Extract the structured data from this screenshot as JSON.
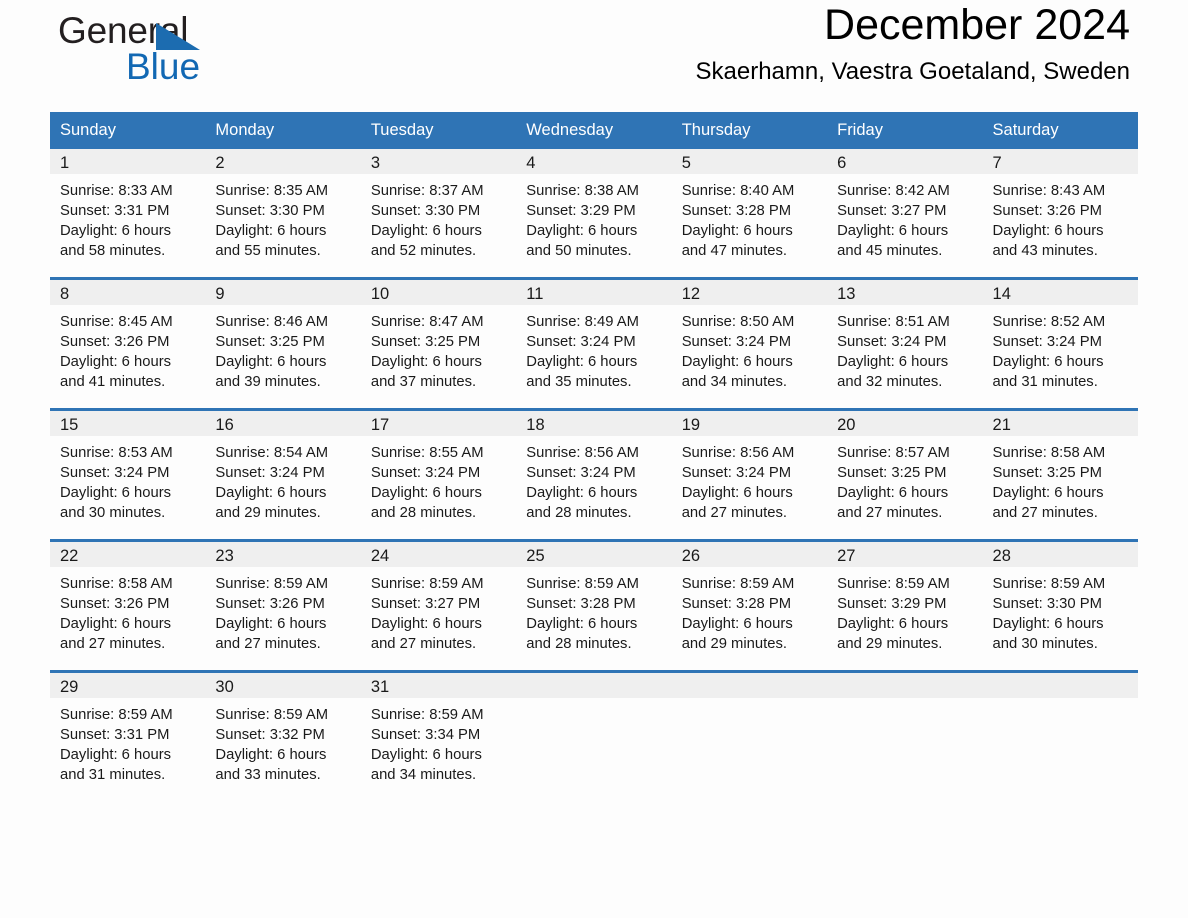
{
  "brand": {
    "name_part1": "General",
    "name_part2": "Blue",
    "triangle_color": "#1c6cb0",
    "blue_color": "#1268b3"
  },
  "header": {
    "title": "December 2024",
    "location": "Skaerhamn, Vaestra Goetaland, Sweden"
  },
  "theme": {
    "header_blue": "#2f74b5",
    "daynum_band": "#efefef",
    "page_background": "#fdfdfd"
  },
  "weekdays": [
    "Sunday",
    "Monday",
    "Tuesday",
    "Wednesday",
    "Thursday",
    "Friday",
    "Saturday"
  ],
  "weeks": [
    [
      {
        "day": "1",
        "sunrise": "Sunrise: 8:33 AM",
        "sunset": "Sunset: 3:31 PM",
        "daylight1": "Daylight: 6 hours",
        "daylight2": "and 58 minutes."
      },
      {
        "day": "2",
        "sunrise": "Sunrise: 8:35 AM",
        "sunset": "Sunset: 3:30 PM",
        "daylight1": "Daylight: 6 hours",
        "daylight2": "and 55 minutes."
      },
      {
        "day": "3",
        "sunrise": "Sunrise: 8:37 AM",
        "sunset": "Sunset: 3:30 PM",
        "daylight1": "Daylight: 6 hours",
        "daylight2": "and 52 minutes."
      },
      {
        "day": "4",
        "sunrise": "Sunrise: 8:38 AM",
        "sunset": "Sunset: 3:29 PM",
        "daylight1": "Daylight: 6 hours",
        "daylight2": "and 50 minutes."
      },
      {
        "day": "5",
        "sunrise": "Sunrise: 8:40 AM",
        "sunset": "Sunset: 3:28 PM",
        "daylight1": "Daylight: 6 hours",
        "daylight2": "and 47 minutes."
      },
      {
        "day": "6",
        "sunrise": "Sunrise: 8:42 AM",
        "sunset": "Sunset: 3:27 PM",
        "daylight1": "Daylight: 6 hours",
        "daylight2": "and 45 minutes."
      },
      {
        "day": "7",
        "sunrise": "Sunrise: 8:43 AM",
        "sunset": "Sunset: 3:26 PM",
        "daylight1": "Daylight: 6 hours",
        "daylight2": "and 43 minutes."
      }
    ],
    [
      {
        "day": "8",
        "sunrise": "Sunrise: 8:45 AM",
        "sunset": "Sunset: 3:26 PM",
        "daylight1": "Daylight: 6 hours",
        "daylight2": "and 41 minutes."
      },
      {
        "day": "9",
        "sunrise": "Sunrise: 8:46 AM",
        "sunset": "Sunset: 3:25 PM",
        "daylight1": "Daylight: 6 hours",
        "daylight2": "and 39 minutes."
      },
      {
        "day": "10",
        "sunrise": "Sunrise: 8:47 AM",
        "sunset": "Sunset: 3:25 PM",
        "daylight1": "Daylight: 6 hours",
        "daylight2": "and 37 minutes."
      },
      {
        "day": "11",
        "sunrise": "Sunrise: 8:49 AM",
        "sunset": "Sunset: 3:24 PM",
        "daylight1": "Daylight: 6 hours",
        "daylight2": "and 35 minutes."
      },
      {
        "day": "12",
        "sunrise": "Sunrise: 8:50 AM",
        "sunset": "Sunset: 3:24 PM",
        "daylight1": "Daylight: 6 hours",
        "daylight2": "and 34 minutes."
      },
      {
        "day": "13",
        "sunrise": "Sunrise: 8:51 AM",
        "sunset": "Sunset: 3:24 PM",
        "daylight1": "Daylight: 6 hours",
        "daylight2": "and 32 minutes."
      },
      {
        "day": "14",
        "sunrise": "Sunrise: 8:52 AM",
        "sunset": "Sunset: 3:24 PM",
        "daylight1": "Daylight: 6 hours",
        "daylight2": "and 31 minutes."
      }
    ],
    [
      {
        "day": "15",
        "sunrise": "Sunrise: 8:53 AM",
        "sunset": "Sunset: 3:24 PM",
        "daylight1": "Daylight: 6 hours",
        "daylight2": "and 30 minutes."
      },
      {
        "day": "16",
        "sunrise": "Sunrise: 8:54 AM",
        "sunset": "Sunset: 3:24 PM",
        "daylight1": "Daylight: 6 hours",
        "daylight2": "and 29 minutes."
      },
      {
        "day": "17",
        "sunrise": "Sunrise: 8:55 AM",
        "sunset": "Sunset: 3:24 PM",
        "daylight1": "Daylight: 6 hours",
        "daylight2": "and 28 minutes."
      },
      {
        "day": "18",
        "sunrise": "Sunrise: 8:56 AM",
        "sunset": "Sunset: 3:24 PM",
        "daylight1": "Daylight: 6 hours",
        "daylight2": "and 28 minutes."
      },
      {
        "day": "19",
        "sunrise": "Sunrise: 8:56 AM",
        "sunset": "Sunset: 3:24 PM",
        "daylight1": "Daylight: 6 hours",
        "daylight2": "and 27 minutes."
      },
      {
        "day": "20",
        "sunrise": "Sunrise: 8:57 AM",
        "sunset": "Sunset: 3:25 PM",
        "daylight1": "Daylight: 6 hours",
        "daylight2": "and 27 minutes."
      },
      {
        "day": "21",
        "sunrise": "Sunrise: 8:58 AM",
        "sunset": "Sunset: 3:25 PM",
        "daylight1": "Daylight: 6 hours",
        "daylight2": "and 27 minutes."
      }
    ],
    [
      {
        "day": "22",
        "sunrise": "Sunrise: 8:58 AM",
        "sunset": "Sunset: 3:26 PM",
        "daylight1": "Daylight: 6 hours",
        "daylight2": "and 27 minutes."
      },
      {
        "day": "23",
        "sunrise": "Sunrise: 8:59 AM",
        "sunset": "Sunset: 3:26 PM",
        "daylight1": "Daylight: 6 hours",
        "daylight2": "and 27 minutes."
      },
      {
        "day": "24",
        "sunrise": "Sunrise: 8:59 AM",
        "sunset": "Sunset: 3:27 PM",
        "daylight1": "Daylight: 6 hours",
        "daylight2": "and 27 minutes."
      },
      {
        "day": "25",
        "sunrise": "Sunrise: 8:59 AM",
        "sunset": "Sunset: 3:28 PM",
        "daylight1": "Daylight: 6 hours",
        "daylight2": "and 28 minutes."
      },
      {
        "day": "26",
        "sunrise": "Sunrise: 8:59 AM",
        "sunset": "Sunset: 3:28 PM",
        "daylight1": "Daylight: 6 hours",
        "daylight2": "and 29 minutes."
      },
      {
        "day": "27",
        "sunrise": "Sunrise: 8:59 AM",
        "sunset": "Sunset: 3:29 PM",
        "daylight1": "Daylight: 6 hours",
        "daylight2": "and 29 minutes."
      },
      {
        "day": "28",
        "sunrise": "Sunrise: 8:59 AM",
        "sunset": "Sunset: 3:30 PM",
        "daylight1": "Daylight: 6 hours",
        "daylight2": "and 30 minutes."
      }
    ],
    [
      {
        "day": "29",
        "sunrise": "Sunrise: 8:59 AM",
        "sunset": "Sunset: 3:31 PM",
        "daylight1": "Daylight: 6 hours",
        "daylight2": "and 31 minutes."
      },
      {
        "day": "30",
        "sunrise": "Sunrise: 8:59 AM",
        "sunset": "Sunset: 3:32 PM",
        "daylight1": "Daylight: 6 hours",
        "daylight2": "and 33 minutes."
      },
      {
        "day": "31",
        "sunrise": "Sunrise: 8:59 AM",
        "sunset": "Sunset: 3:34 PM",
        "daylight1": "Daylight: 6 hours",
        "daylight2": "and 34 minutes."
      },
      {
        "day": "",
        "sunrise": "",
        "sunset": "",
        "daylight1": "",
        "daylight2": ""
      },
      {
        "day": "",
        "sunrise": "",
        "sunset": "",
        "daylight1": "",
        "daylight2": ""
      },
      {
        "day": "",
        "sunrise": "",
        "sunset": "",
        "daylight1": "",
        "daylight2": ""
      },
      {
        "day": "",
        "sunrise": "",
        "sunset": "",
        "daylight1": "",
        "daylight2": ""
      }
    ]
  ]
}
